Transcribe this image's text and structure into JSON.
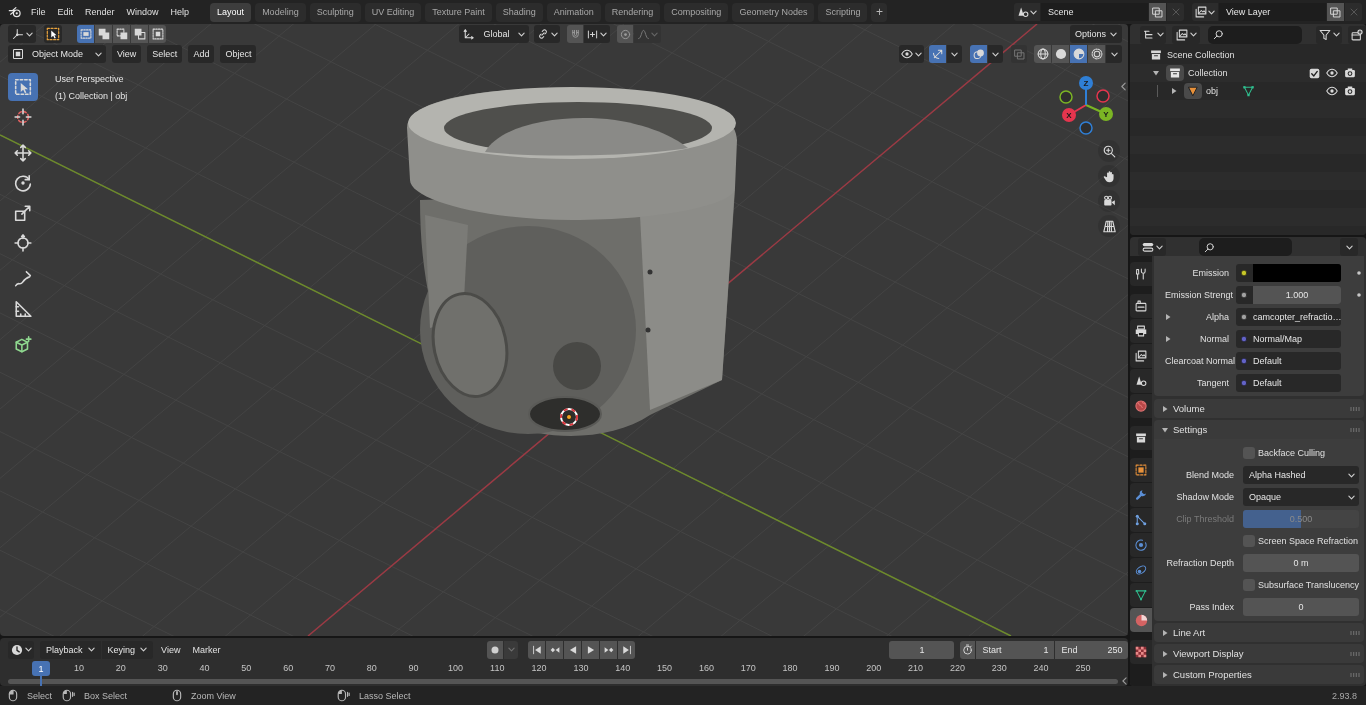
{
  "top_bar": {
    "menus": [
      "File",
      "Edit",
      "Render",
      "Window",
      "Help"
    ],
    "workspaces": [
      {
        "label": "Layout",
        "selected": true
      },
      {
        "label": "Modeling",
        "selected": false
      },
      {
        "label": "Sculpting",
        "selected": false
      },
      {
        "label": "UV Editing",
        "selected": false
      },
      {
        "label": "Texture Paint",
        "selected": false
      },
      {
        "label": "Shading",
        "selected": false
      },
      {
        "label": "Animation",
        "selected": false
      },
      {
        "label": "Rendering",
        "selected": false
      },
      {
        "label": "Compositing",
        "selected": false
      },
      {
        "label": "Geometry Nodes",
        "selected": false
      },
      {
        "label": "Scripting",
        "selected": false
      }
    ],
    "add_workspace": "+",
    "scene": "Scene",
    "view_layer": "View Layer"
  },
  "viewport": {
    "select_modes": [
      {
        "kind": "set",
        "selected": true
      },
      {
        "kind": "extend",
        "selected": false
      },
      {
        "kind": "subtract",
        "selected": false
      },
      {
        "kind": "difference",
        "selected": false
      },
      {
        "kind": "intersect",
        "selected": false
      }
    ],
    "orientation": "Global",
    "options": "Options",
    "mode": "Object Mode",
    "menus": [
      "View",
      "Select",
      "Add",
      "Object"
    ],
    "toggles": [
      {
        "kind": "gizmo",
        "on": true
      },
      {
        "kind": "overlay",
        "on": true
      },
      {
        "kind": "xray",
        "on": false
      }
    ],
    "shading": [
      {
        "kind": "wireframe",
        "selected": false
      },
      {
        "kind": "solid",
        "selected": false
      },
      {
        "kind": "material",
        "selected": true
      },
      {
        "kind": "rendered",
        "selected": false
      }
    ],
    "info": [
      "User Perspective",
      "(1) Collection | obj"
    ],
    "tools": [
      {
        "kind": "select",
        "selected": true
      },
      {
        "kind": "cursor",
        "selected": false
      },
      {
        "kind": "move",
        "selected": false
      },
      {
        "kind": "rotate",
        "selected": false
      },
      {
        "kind": "scale",
        "selected": false
      },
      {
        "kind": "transform",
        "selected": false
      },
      {
        "kind": "annotate",
        "selected": false
      },
      {
        "kind": "measure",
        "selected": false
      },
      {
        "kind": "add_cube",
        "selected": false
      }
    ],
    "gizmo_axes": [
      {
        "label": "X",
        "color": "#e6354e"
      },
      {
        "label": "Y",
        "color": "#7bb524"
      },
      {
        "label": "Z",
        "color": "#2f7fd6"
      }
    ]
  },
  "timeline": {
    "dropdowns": [
      "Playback",
      "Keying"
    ],
    "menus": [
      "View",
      "Marker"
    ],
    "auto_keying": false,
    "transport": [
      {
        "kind": "jump_start"
      },
      {
        "kind": "prev_key"
      },
      {
        "kind": "play_reverse"
      },
      {
        "kind": "play"
      },
      {
        "kind": "next_key"
      },
      {
        "kind": "jump_end"
      }
    ],
    "current_frame": "1",
    "start_label": "Start",
    "start": "1",
    "end_label": "End",
    "end": "250",
    "playhead": "1",
    "ruler": [
      "10",
      "20",
      "30",
      "40",
      "50",
      "60",
      "70",
      "80",
      "90",
      "100",
      "110",
      "120",
      "130",
      "140",
      "150",
      "160",
      "170",
      "180",
      "190",
      "200",
      "210",
      "220",
      "230",
      "240",
      "250"
    ]
  },
  "outliner": {
    "tree": [
      {
        "kind": "scene_collection",
        "label": "Scene Collection",
        "children": [
          {
            "kind": "collection",
            "label": "Collection",
            "expanded": true,
            "checked": true,
            "children": [
              {
                "kind": "mesh_object",
                "label": "obj",
                "expanded": false
              }
            ]
          }
        ]
      }
    ]
  },
  "properties": {
    "tabs": [
      {
        "kind": "tool",
        "selected": false
      },
      {
        "kind": "render",
        "selected": false
      },
      {
        "kind": "output",
        "selected": false
      },
      {
        "kind": "view_layer",
        "selected": false
      },
      {
        "kind": "scene",
        "selected": false
      },
      {
        "kind": "world",
        "selected": false
      },
      {
        "kind": "collection",
        "selected": false
      },
      {
        "kind": "object",
        "selected": false
      },
      {
        "kind": "modifiers",
        "selected": false
      },
      {
        "kind": "particles",
        "selected": false
      },
      {
        "kind": "physics",
        "selected": false
      },
      {
        "kind": "constraints",
        "selected": false
      },
      {
        "kind": "data",
        "selected": false
      },
      {
        "kind": "material",
        "selected": true
      },
      {
        "kind": "texture",
        "selected": false
      }
    ],
    "inputs": [
      {
        "label": "Emission",
        "kind": "color",
        "color": "#c7c729"
      },
      {
        "label": "Emission Strengt",
        "kind": "number",
        "color": "#a1a1a1",
        "value": "1.000"
      },
      {
        "label": "Alpha",
        "kind": "link",
        "color": "#a1a1a1",
        "value": "camcopter_refractio…",
        "expanded": false
      },
      {
        "label": "Normal",
        "kind": "link",
        "color": "#6363c7",
        "value": "Normal/Map",
        "expanded": false
      },
      {
        "label": "Clearcoat Normal",
        "kind": "socket",
        "color": "#6363c7",
        "value": "Default"
      },
      {
        "label": "Tangent",
        "kind": "socket",
        "color": "#6363c7",
        "value": "Default"
      }
    ],
    "panels": [
      {
        "label": "Volume",
        "expanded": false
      },
      {
        "label": "Settings",
        "expanded": true,
        "rows": [
          {
            "kind": "checkbox",
            "label": "Backface Culling",
            "checked": false
          },
          {
            "kind": "dropdown",
            "label": "Blend Mode",
            "value": "Alpha Hashed"
          },
          {
            "kind": "dropdown",
            "label": "Shadow Mode",
            "value": "Opaque"
          },
          {
            "kind": "slider",
            "label": "Clip Threshold",
            "value": "0.500",
            "level": 0.5,
            "disabled": true
          },
          {
            "kind": "checkbox",
            "label": "Screen Space Refraction",
            "checked": false
          },
          {
            "kind": "number",
            "label": "Refraction Depth",
            "value": "0 m"
          },
          {
            "kind": "checkbox",
            "label": "Subsurface Translucency",
            "checked": false
          },
          {
            "kind": "number",
            "label": "Pass Index",
            "value": "0"
          }
        ]
      },
      {
        "label": "Line Art",
        "expanded": false
      },
      {
        "label": "Viewport Display",
        "expanded": false
      },
      {
        "label": "Custom Properties",
        "expanded": false
      }
    ]
  },
  "status_bar": {
    "hints": [
      {
        "kind": "click",
        "label": "Select"
      },
      {
        "kind": "drag",
        "label": "Box Select"
      },
      {
        "kind": "middle",
        "label": "Zoom View"
      },
      {
        "kind": "drag",
        "label": "Lasso Select"
      }
    ],
    "version": "2.93.8"
  }
}
